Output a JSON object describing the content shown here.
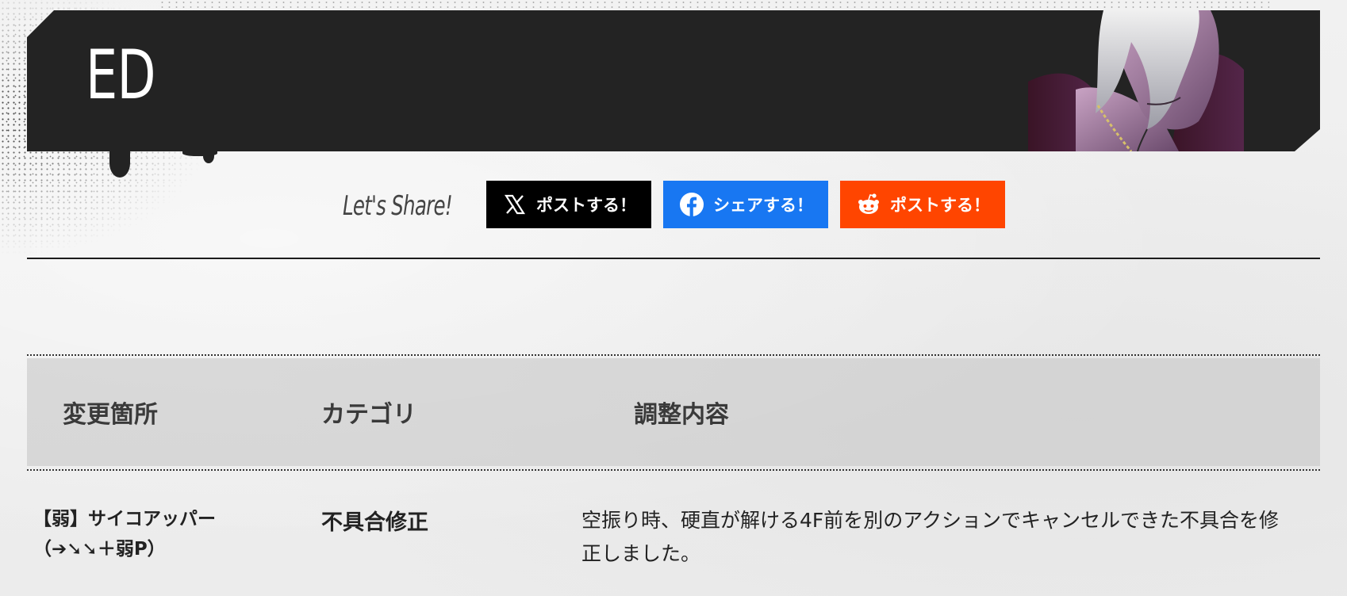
{
  "header": {
    "title": "ED",
    "portrait": "character-portrait-ed"
  },
  "share": {
    "label": "Let's Share!",
    "buttons": [
      {
        "icon": "x-logo-icon",
        "label": "ポストする！",
        "color": "#000000"
      },
      {
        "icon": "facebook-logo-icon",
        "label": "シェアする！",
        "color": "#1877f2"
      },
      {
        "icon": "reddit-logo-icon",
        "label": "ポストする！",
        "color": "#ff4500"
      }
    ]
  },
  "table": {
    "headers": [
      "変更箇所",
      "カテゴリ",
      "調整内容"
    ],
    "rows": [
      {
        "location_line1": "【弱】サイコアッパー",
        "location_line2": "（➔➘➘＋弱P）",
        "category": "不具合修正",
        "detail": "空振り時、硬直が解ける4F前を別のアクションでキャンセルできた不具合を修正しました。"
      }
    ]
  }
}
